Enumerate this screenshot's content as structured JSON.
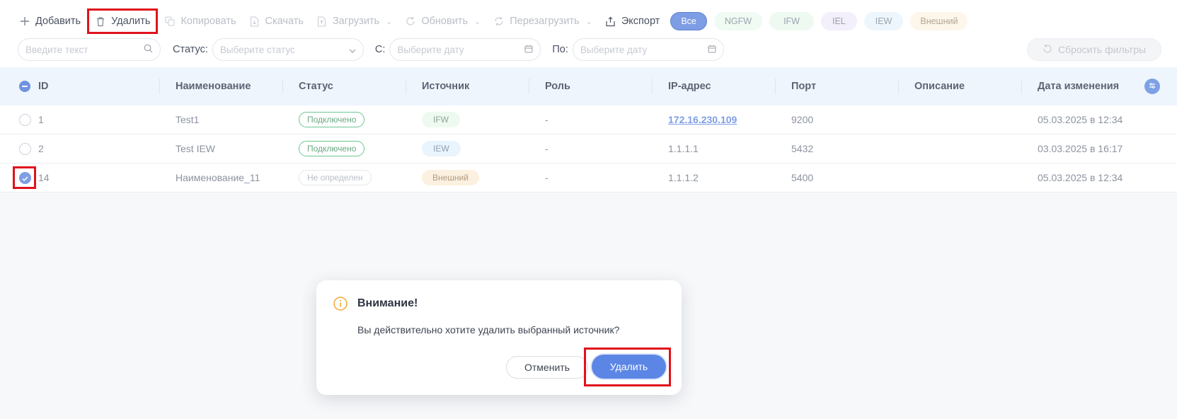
{
  "toolbar": {
    "add_label": "Добавить",
    "delete_label": "Удалить",
    "copy_label": "Копировать",
    "download_label": "Скачать",
    "upload_label": "Загрузить",
    "update_label": "Обновить",
    "reboot_label": "Перезагрузить",
    "export_label": "Экспорт"
  },
  "chips": {
    "all": "Все",
    "ngfw": "NGFW",
    "ifw": "IFW",
    "iel": "IEL",
    "iew": "IEW",
    "ext": "Внешний"
  },
  "filters": {
    "search_placeholder": "Введите текст",
    "status_label": "Статус:",
    "status_placeholder": "Выберите статус",
    "from_label": "С:",
    "from_placeholder": "Выберите дату",
    "to_label": "По:",
    "to_placeholder": "Выберите дату",
    "reset_label": "Сбросить фильтры"
  },
  "table": {
    "columns": [
      "ID",
      "Наименование",
      "Статус",
      "Источник",
      "Роль",
      "IP-адрес",
      "Порт",
      "Описание",
      "Дата изменения"
    ],
    "rows": [
      {
        "id": "1",
        "name": "Test1",
        "status": "Подключено",
        "source": "IFW",
        "role": "-",
        "ip": "172.16.230.109",
        "port": "9200",
        "desc": "",
        "date": "05.03.2025 в 12:34",
        "checked": false
      },
      {
        "id": "2",
        "name": "Test IEW",
        "status": "Подключено",
        "source": "IEW",
        "role": "-",
        "ip": "1.1.1.1",
        "port": "5432",
        "desc": "",
        "date": "03.03.2025 в 16:17",
        "checked": false
      },
      {
        "id": "14",
        "name": "Наименование_11",
        "status": "Не определен",
        "source": "Внешний",
        "role": "-",
        "ip": "1.1.1.2",
        "port": "5400",
        "desc": "",
        "date": "05.03.2025 в 12:34",
        "checked": true
      }
    ]
  },
  "dialog": {
    "title": "Внимание!",
    "message": "Вы действительно хотите удалить выбранный источник?",
    "cancel_label": "Отменить",
    "confirm_label": "Удалить"
  },
  "colors": {
    "accent": "#5b86e5",
    "highlight": "#e0121c",
    "connected": "#6cc58f",
    "warning_icon": "#f0a92e"
  }
}
